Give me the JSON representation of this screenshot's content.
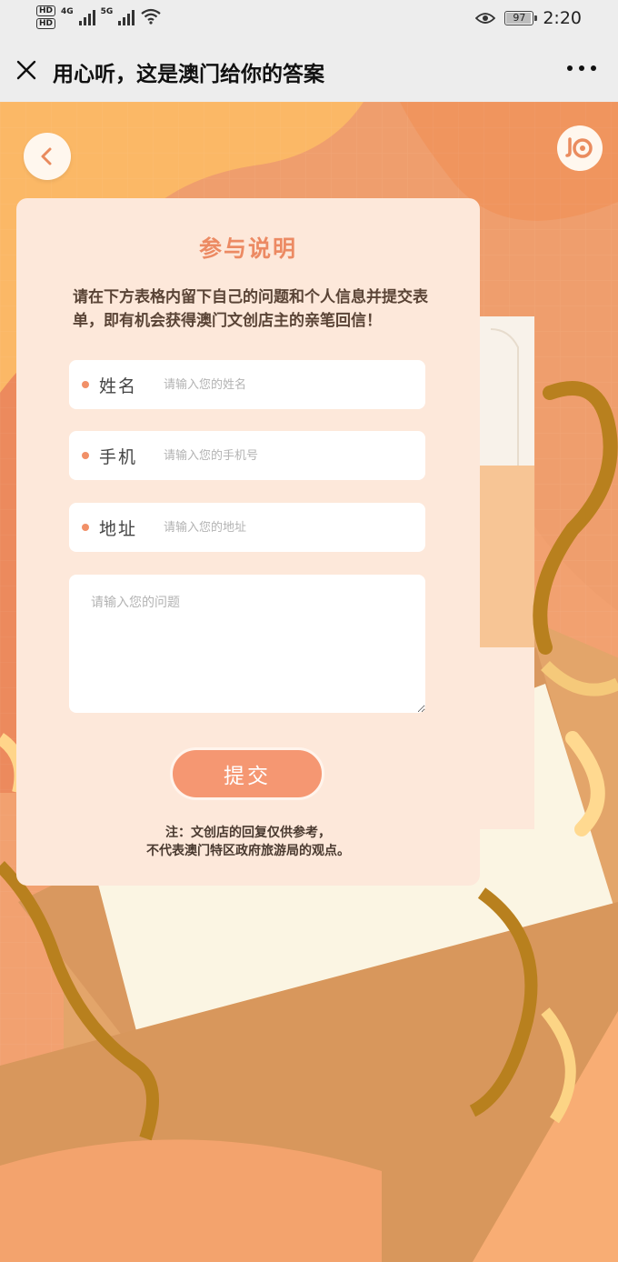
{
  "status_bar": {
    "hd1": "HD",
    "hd2": "HD",
    "net1": "4G",
    "net2": "5G",
    "battery": "97",
    "battery_level": 0.97,
    "time": "2:20"
  },
  "title_bar": {
    "title": "用心听，这是澳门给你的答案"
  },
  "form": {
    "title": "参与说明",
    "description": "请在下方表格内留下自己的问题和个人信息并提交表单，即有机会获得澳门文创店主的亲笔回信！",
    "name_label": "姓名",
    "name_placeholder": "请输入您的姓名",
    "phone_label": "手机",
    "phone_placeholder": "请输入您的手机号",
    "address_label": "地址",
    "address_placeholder": "请输入您的地址",
    "question_placeholder": "请输入您的问题",
    "submit_label": "提交",
    "note_line1": "注：文创店的回复仅供参考，",
    "note_line2": "不代表澳门特区政府旅游局的观点。"
  },
  "colors": {
    "accent": "#ec8a63",
    "button": "#f59772",
    "card": "#fde8da",
    "ribbon": "#b8801e"
  }
}
